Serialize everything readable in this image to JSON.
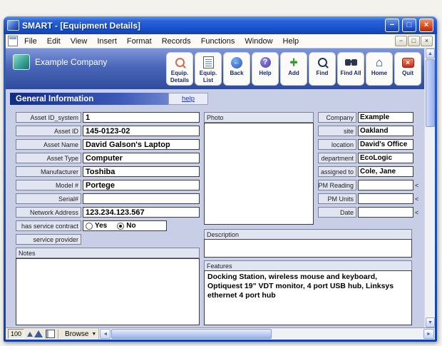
{
  "window": {
    "title": "SMART - [Equipment Details]",
    "controls": {
      "minimize": "−",
      "maximize": "□",
      "close": "×"
    }
  },
  "menubar": {
    "items": [
      "File",
      "Edit",
      "View",
      "Insert",
      "Format",
      "Records",
      "Functions",
      "Window",
      "Help"
    ],
    "mdi_controls": {
      "minimize": "−",
      "restore": "□",
      "close": "×"
    }
  },
  "toolbar": {
    "company_name": "Example Company",
    "buttons": [
      {
        "label": "Equip.\nDetails",
        "icon": "equip-details-icon"
      },
      {
        "label": "Equip.\nList",
        "icon": "equip-list-icon"
      },
      {
        "label": "Back",
        "icon": "back-icon"
      },
      {
        "label": "Help",
        "icon": "help-icon"
      },
      {
        "label": "Add",
        "icon": "add-icon"
      },
      {
        "label": "Find",
        "icon": "find-icon"
      },
      {
        "label": "Find All",
        "icon": "find-all-icon"
      },
      {
        "label": "Home",
        "icon": "home-icon"
      },
      {
        "label": "Quit",
        "icon": "quit-icon"
      }
    ]
  },
  "section": {
    "title": "General Information",
    "help_link": "help"
  },
  "form": {
    "left": [
      {
        "label": "Asset ID_system",
        "value": "1"
      },
      {
        "label": "Asset ID",
        "value": "145-0123-02"
      },
      {
        "label": "Asset Name",
        "value": "David Galson's Laptop"
      },
      {
        "label": "Asset Type",
        "value": "Computer"
      },
      {
        "label": "Manufacturer",
        "value": "Toshiba"
      },
      {
        "label": "Model #",
        "value": "Portege"
      },
      {
        "label": "Serial#",
        "value": ""
      },
      {
        "label": "Network Address",
        "value": "123.234.123.567"
      }
    ],
    "service_contract": {
      "label": "has service contract",
      "options": [
        {
          "label": "Yes",
          "checked": "false"
        },
        {
          "label": "No",
          "checked": "true"
        }
      ]
    },
    "service_provider": {
      "label": "service provider",
      "value": ""
    },
    "notes": {
      "label": "Notes",
      "value": ""
    },
    "photo": {
      "label": "Photo"
    },
    "description": {
      "label": "Description",
      "value": ""
    },
    "features": {
      "label": "Features",
      "value": "Docking Station, wireless mouse and keyboard, Optiquest 19\" VDT monitor, 4 port USB hub, Linksys ethernet 4 port hub"
    },
    "right": [
      {
        "label": "Company",
        "value": "Example"
      },
      {
        "label": "site",
        "value": "Oakland"
      },
      {
        "label": "location",
        "value": "David's Office"
      },
      {
        "label": "department",
        "value": "EcoLogic"
      },
      {
        "label": "assigned to",
        "value": "Cole, Jane"
      },
      {
        "label": "PM Reading",
        "value": "",
        "marker": "<"
      },
      {
        "label": "PM Units",
        "value": "",
        "marker": "<"
      },
      {
        "label": "Date",
        "value": "",
        "marker": "<"
      }
    ]
  },
  "statusbar": {
    "zoom_level": "100",
    "mode": "Browse"
  }
}
